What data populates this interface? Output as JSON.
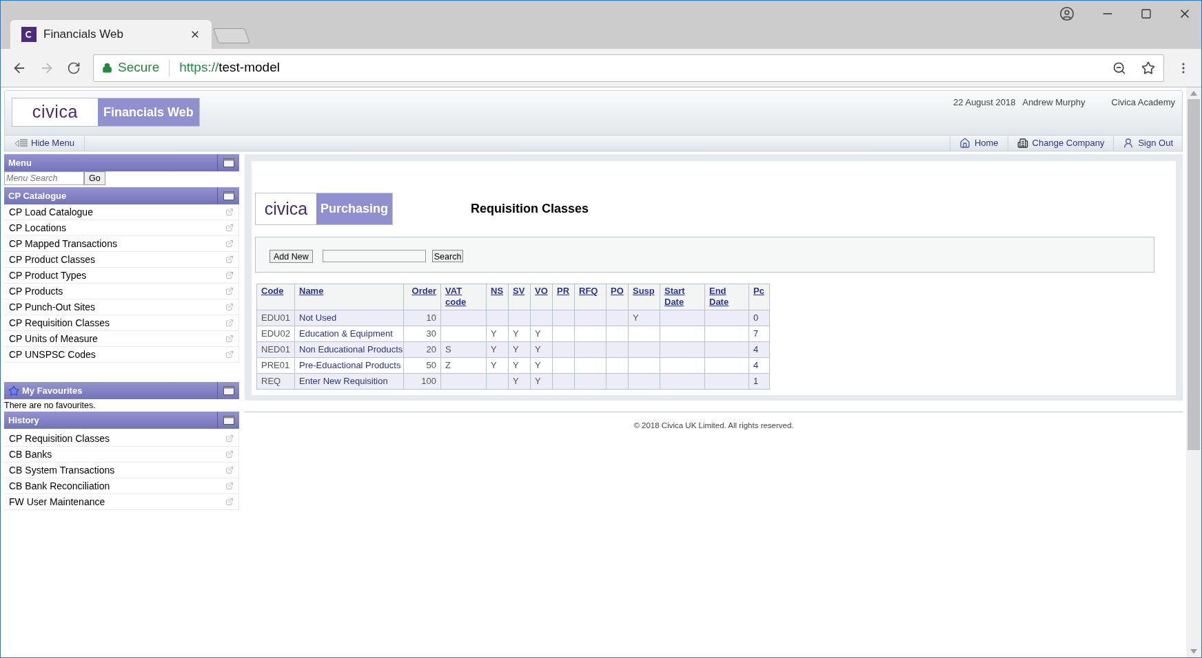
{
  "browser": {
    "tab_title": "Financials Web",
    "secure_label": "Secure",
    "url_scheme": "https://",
    "url_host": "test-model"
  },
  "header": {
    "logo_text": "civica",
    "product": "Financials Web",
    "date": "22 August 2018",
    "user": "Andrew Murphy",
    "company": "Civica Academy"
  },
  "toolbar": {
    "hide_menu": "Hide Menu",
    "links": [
      {
        "kind": "home",
        "label": "Home"
      },
      {
        "kind": "company",
        "label": "Change Company"
      },
      {
        "kind": "signout",
        "label": "Sign Out"
      }
    ]
  },
  "sidebar": {
    "menu_title": "Menu",
    "search_placeholder": "Menu Search",
    "go": "Go",
    "catalogue_title": "CP Catalogue",
    "catalogue_items": [
      "CP Load Catalogue",
      "CP Locations",
      "CP Mapped Transactions",
      "CP Product Classes",
      "CP Product Types",
      "CP Products",
      "CP Punch-Out Sites",
      "CP Requisition Classes",
      "CP Units of Measure",
      "CP UNSPSC Codes"
    ],
    "favourites_title": "My Favourites",
    "favourites_empty": "There are no favourites.",
    "history_title": "History",
    "history_items": [
      "CP Requisition Classes",
      "CB Banks",
      "CB System Transactions",
      "CB Bank Reconciliation",
      "FW User Maintenance"
    ]
  },
  "main": {
    "logo_text": "civica",
    "module": "Purchasing",
    "title": "Requisition Classes",
    "add_new": "Add New",
    "search": "Search",
    "table": {
      "columns": [
        {
          "label": "Code",
          "numeric": false
        },
        {
          "label": "Name",
          "numeric": false
        },
        {
          "label": "Order",
          "numeric": true
        },
        {
          "label": "VAT code",
          "numeric": false
        },
        {
          "label": "NS",
          "numeric": false
        },
        {
          "label": "SV",
          "numeric": false
        },
        {
          "label": "VO",
          "numeric": false
        },
        {
          "label": "PR",
          "numeric": false
        },
        {
          "label": "RFQ",
          "numeric": false
        },
        {
          "label": "PO",
          "numeric": false
        },
        {
          "label": "Susp",
          "numeric": false
        },
        {
          "label": "Start Date",
          "numeric": false
        },
        {
          "label": "End Date",
          "numeric": false
        },
        {
          "label": "Pc",
          "numeric": false
        }
      ],
      "rows": [
        [
          "EDU01",
          "Not Used",
          "10",
          null,
          null,
          null,
          null,
          null,
          null,
          null,
          "Y",
          null,
          null,
          "0"
        ],
        [
          "EDU02",
          "Education & Equipment",
          "30",
          null,
          "Y",
          "Y",
          "Y",
          null,
          null,
          null,
          null,
          null,
          null,
          "7"
        ],
        [
          "NED01",
          "Non Educational Products",
          "20",
          "S",
          "Y",
          "Y",
          "Y",
          null,
          null,
          null,
          null,
          null,
          null,
          "4"
        ],
        [
          "PRE01",
          "Pre-Eduactional Products",
          "50",
          "Z",
          "Y",
          "Y",
          "Y",
          null,
          null,
          null,
          null,
          null,
          null,
          "4"
        ],
        [
          "REQ",
          "Enter New Requisition",
          "100",
          null,
          null,
          "Y",
          "Y",
          null,
          null,
          null,
          null,
          null,
          null,
          "1"
        ]
      ]
    }
  },
  "footer": "© 2018 Civica UK Limited. All rights reserved."
}
